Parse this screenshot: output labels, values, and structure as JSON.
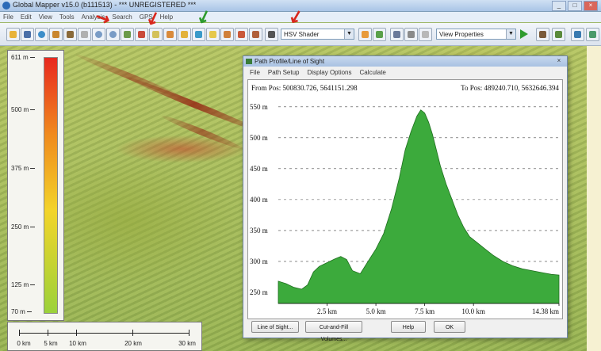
{
  "window": {
    "title": "Global Mapper v15.0 (b111513) - *** UNREGISTERED ***"
  },
  "menu": [
    "File",
    "Edit",
    "View",
    "Tools",
    "Analysis",
    "Search",
    "GPS",
    "Help"
  ],
  "toolbar": {
    "shader_select": "HSV Shader",
    "view_select": "View Properties"
  },
  "legend": {
    "labels": [
      "611 m",
      "500 m",
      "375 m",
      "250 m",
      "125 m",
      "70 m"
    ]
  },
  "scalebar": {
    "labels": [
      "0 km",
      "5 km",
      "10 km",
      "20 km",
      "30 km"
    ]
  },
  "dialog": {
    "title": "Path Profile/Line of Sight",
    "menu": [
      "File",
      "Path Setup",
      "Display Options",
      "Calculate"
    ],
    "from_pos": "From Pos: 500830.726, 5641151.298",
    "to_pos": "To Pos: 489240.710, 5632646.394",
    "buttons": [
      "Line of Sight...",
      "Cut-and-Fill Volumes...",
      "Help",
      "OK"
    ]
  },
  "colors": {
    "profile_fill": "#3caa3c",
    "profile_stroke": "#1f6e1f",
    "annotation_red": "#d8281e",
    "annotation_green": "#2e9b2e"
  },
  "chart_data": {
    "type": "area",
    "title": "",
    "xlabel": "",
    "ylabel": "",
    "xlim": [
      0,
      14.38
    ],
    "ylim": [
      232,
      560
    ],
    "x_ticks": [
      2.5,
      5.0,
      7.5,
      10.0,
      14.38
    ],
    "x_tick_labels": [
      "2.5 km",
      "5.0 km",
      "7.5 km",
      "10.0 km",
      "14.38 km"
    ],
    "y_ticks": [
      250,
      300,
      350,
      400,
      450,
      500,
      550
    ],
    "y_tick_labels": [
      "250 m",
      "300 m",
      "350 m",
      "400 m",
      "450 m",
      "500 m",
      "550 m"
    ],
    "grid": true,
    "x": [
      0,
      0.4,
      0.8,
      1.2,
      1.5,
      1.8,
      2.1,
      2.5,
      2.9,
      3.2,
      3.5,
      3.8,
      4.2,
      4.6,
      5.0,
      5.4,
      5.8,
      6.2,
      6.5,
      6.8,
      7.1,
      7.3,
      7.5,
      7.7,
      7.9,
      8.1,
      8.3,
      8.6,
      8.9,
      9.2,
      9.5,
      9.8,
      10.2,
      10.6,
      11.0,
      11.5,
      12.0,
      12.5,
      13.0,
      13.5,
      14.0,
      14.38
    ],
    "values": [
      268,
      264,
      258,
      255,
      262,
      283,
      292,
      298,
      304,
      308,
      303,
      285,
      280,
      300,
      320,
      345,
      385,
      435,
      480,
      510,
      535,
      545,
      540,
      525,
      505,
      480,
      455,
      425,
      400,
      375,
      355,
      340,
      330,
      320,
      310,
      300,
      293,
      288,
      285,
      282,
      279,
      278
    ]
  }
}
